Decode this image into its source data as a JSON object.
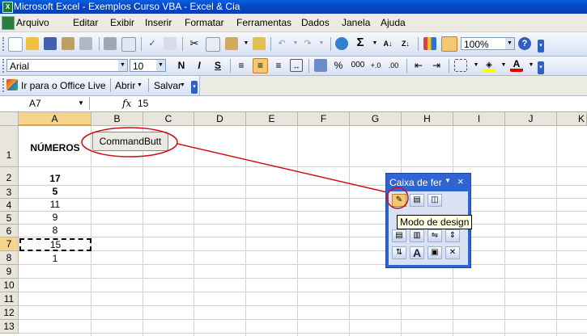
{
  "title": "Microsoft Excel - Exemplos Curso VBA - Excel & Cia",
  "menu": [
    "Arquivo",
    "Editar",
    "Exibir",
    "Inserir",
    "Formatar",
    "Ferramentas",
    "Dados",
    "Janela",
    "Ajuda"
  ],
  "toolbar": {
    "zoom": "100%"
  },
  "format": {
    "font": "Arial",
    "size": "10",
    "bold": "N",
    "italic": "I",
    "underline": "S",
    "percent": "%",
    "thousands": "000"
  },
  "web": {
    "office_live": "Ir para o Office Live",
    "open": "Abrir",
    "save": "Salvar"
  },
  "formula": {
    "namebox": "A7",
    "fx": "fx",
    "value": "15"
  },
  "columns": [
    "A",
    "B",
    "C",
    "D",
    "E",
    "F",
    "G",
    "H",
    "I",
    "J",
    "K"
  ],
  "rows": [
    "1",
    "2",
    "3",
    "4",
    "5",
    "6",
    "7",
    "8",
    "9",
    "10",
    "11",
    "12",
    "13"
  ],
  "cells": {
    "a1": "NÚMEROS",
    "a2": "17",
    "a3": "5",
    "a4": "11",
    "a5": "9",
    "a6": "8",
    "a7": "15",
    "a8": "1"
  },
  "command_button": "CommandButt",
  "toolbox": {
    "title": "Caixa de fer",
    "tooltip": "Modo de design"
  },
  "colors": {
    "accent": "#316ac5",
    "annotation": "#d01010"
  }
}
